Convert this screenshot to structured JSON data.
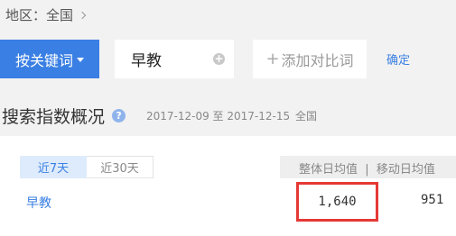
{
  "region": {
    "label": "地区：全国"
  },
  "search": {
    "keyword_button_label": "按关键词",
    "keyword_value": "早教",
    "add_compare_label": "添加对比词",
    "confirm_label": "确定"
  },
  "overview": {
    "title": "搜索指数概况",
    "date_range": "2017-12-09 至 2017-12-15",
    "area": "全国"
  },
  "panel": {
    "tabs": [
      {
        "label": "近7天",
        "active": true
      },
      {
        "label": "近30天",
        "active": false
      }
    ],
    "column_header": "整体日均值  |  移动日均值",
    "row": {
      "keyword": "早教",
      "overall_avg": "1,640",
      "mobile_avg": "951"
    }
  },
  "colors": {
    "accent": "#3a7fe3",
    "highlight_box": "#e53935"
  },
  "icons": [
    "chevron-right-icon",
    "dropdown-caret-icon",
    "plus-circle-icon",
    "plus-icon",
    "help-icon"
  ]
}
